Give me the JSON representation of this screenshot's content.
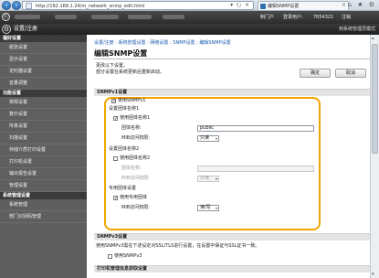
{
  "browser": {
    "url": "http://192.168.1.24/m_network_snmp_edit.html",
    "tab_title": "编辑SNMP设置",
    "tools": "▾ ⭮ ×",
    "tab_close": "×",
    "window_controls": "⌂ ★ ⚙",
    "back": "‹",
    "forward": "›"
  },
  "header": {
    "top_right_1": "制门户",
    "top_right_2": "登录用户:",
    "top_right_3": "7654321",
    "top_right_4": "注销",
    "brand_icon": "Ⓒ",
    "title": "设置/注册",
    "right_link": "到系统管理员模式",
    "gear_icon": "⚙"
  },
  "sidebar": {
    "sections": [
      {
        "title": "偏好设置",
        "items": [
          "纸张设置",
          "显示设置",
          "定时器设置",
          "音量调整"
        ]
      },
      {
        "title": "功能设置",
        "items": [
          "常规设置",
          "复印设置",
          "传真设置",
          "扫描设置",
          "存储介质打印设置",
          "打印机设置",
          "输出报告设置",
          "管理设置"
        ]
      },
      {
        "title": "系统管理设置",
        "items": [
          "系统管理",
          "部门识别码管理"
        ]
      }
    ]
  },
  "main": {
    "breadcrumb": "设置/注册 : 系统管理设置 : 网络设置 : SNMP设置 : 编辑SNMP设置",
    "title": "编辑SNMP设置",
    "msg1": "更改以下设置。",
    "msg2": "部分设置在系统更新后重新启动。",
    "ok_label": "确定",
    "cancel_label": "取消",
    "v1_section": "SNMPv1设置",
    "use_v1_label": "使用SNMPv1",
    "community1_header": "设置团体名称1",
    "use_community1_label": "使用团体名称1",
    "community_name_label": "团体名称:",
    "community1_value": "public",
    "mib_access_label": "MIB访问权限:",
    "mib_access1_value": "只读",
    "community2_header": "设置团体名称2",
    "use_community2_label": "使用团体名称2",
    "community2_value": "",
    "mib_access2_value": "只读",
    "dedicated_header": "专用团体设置",
    "use_dedicated_label": "使用专用团体",
    "mib_access3_value": "读/写",
    "v3_section": "SNMPv3设置",
    "v3_note": "使用SNMPv3需在下述设定对SSL/TLS进行设置，在设置中保证与SSL证书一致。",
    "use_v3_label": "使用SNMPv3",
    "printer_section": "打印机管理信息获取设置",
    "checked_mark": "✓",
    "arrow": "▾"
  },
  "scrollbar": {
    "up": "▴",
    "down": "▾"
  }
}
